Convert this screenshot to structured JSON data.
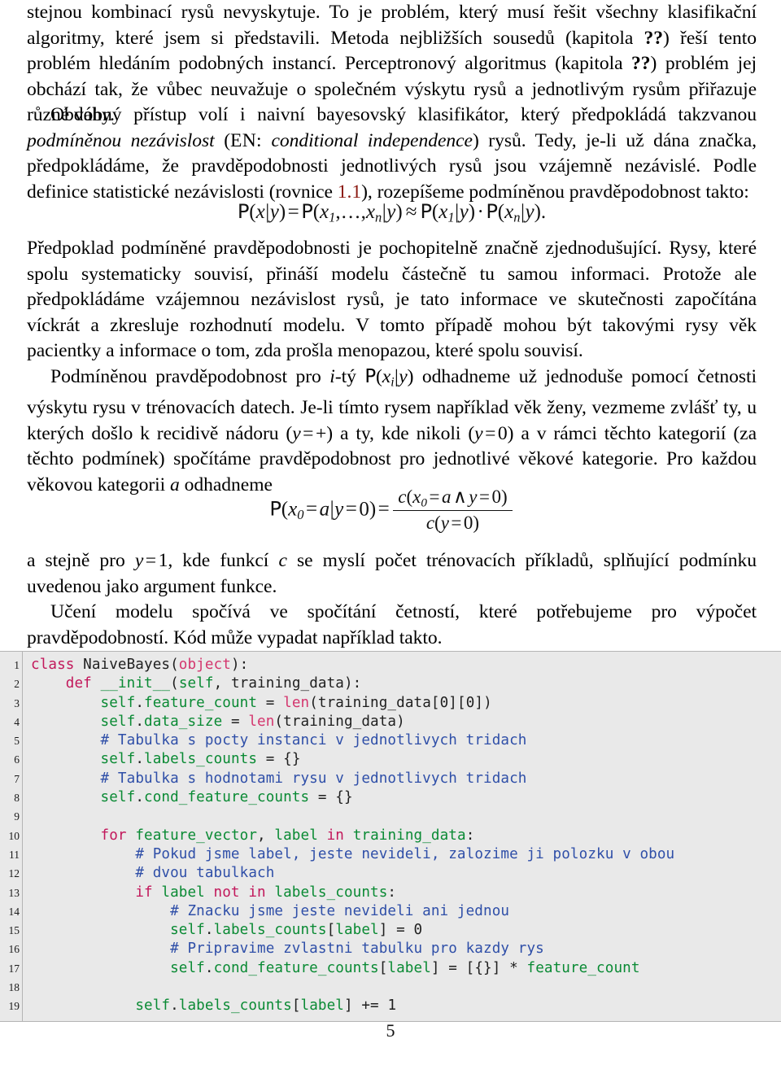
{
  "document": {
    "language": "cs",
    "page_number": "5"
  },
  "body": {
    "paragraph_1": {
      "parts": [
        "stejnou kombinací rysů nevyskytuje. To je problém, který musí řešit všechny klasifikační algoritmy, které jsem si představili. Metoda nejbližších sousedů (kapitola ",
        "??",
        ") řeší tento problém hledáním podobných instancí. Perceptronový algoritmus (kapitola ",
        "??",
        ") problém jej obchází tak, že vůbec neuvažuje o společném výskytu rysů a jednotlivým rysům přiřazuje různé váhy."
      ],
      "ref_marker_1": "??",
      "ref_marker_2": "??"
    },
    "paragraph_2": {
      "text_a": "Obdobný přístup volí i naivní bayesovský klasifikátor, který předpokládá takzvanou ",
      "em_a": "podmíněnou nezávislost",
      "text_b": " (",
      "smallcaps": "EN:",
      "text_c": " ",
      "em_b": "conditional independence",
      "text_d": ") rysů. Tedy, je-li už dána značka, předpokládáme, že pravděpodobnosti jednotlivých rysů jsou vzájemně nezávislé. Podle definice statistické nezávislosti (rovnice ",
      "ref": "1.1",
      "text_e": "), rozepíšeme podmíněnou pravděpodobnost takto:"
    },
    "equation_1": {
      "latex": "P(x|y) = P(x_1, ..., x_n|y) ≈ P(x_1|y) · P(x_n|y).",
      "tokens": {
        "P": "P",
        "x": "x",
        "y": "y",
        "n": "n",
        "one": "1",
        "eq": "=",
        "approx": "≈",
        "cdot": "·",
        "comma": ",",
        "dots": "…",
        "period": ".",
        "bar": "|"
      }
    },
    "paragraph_3": "Předpoklad podmíněné pravděpodobnosti je pochopitelně značně zjednodušující. Rysy, které spolu systematicky souvisí, přináší modelu částečně tu samou informaci. Protože ale předpokládáme vzájemnou nezávislost rysů, je tato informace ve skutečnosti započítána víckrát a zkresluje rozhodnutí modelu. V tomto případě mohou být takovými rysy věk pacientky a informace o tom, zda prošla menopazou, které spolu souvisí.",
    "paragraph_4": {
      "text_a": "Podmíněnou pravděpodobnost pro ",
      "em_i": "i",
      "text_b": "-tý ",
      "math": "P(x_i|y)",
      "text_c": " odhadneme už jednoduše pomocí četnosti výskytu rysu v trénovacích datech. Je-li tímto rysem například věk ženy, vezmeme zvlášť ty, u kterých došlo k recidivě nádoru ",
      "math_b": "(y = +)",
      "text_d": " a ty, kde nikoli ",
      "math_c": "(y = 0)",
      "text_e": " a v rámci těchto kategorií (za těchto podmínek) spočítáme pravděpodobnost pro jednotlivé věkové kategorie. Pro každou věkovou kategorii ",
      "em_a": "a",
      "text_f": " odhadneme"
    },
    "equation_2": {
      "latex": "P(x_0 = a|y = 0) = c(x_0 = a ∧ y = 0) / c(y = 0)",
      "tokens": {
        "P": "P",
        "c": "c",
        "x": "x",
        "y": "y",
        "a": "a",
        "zero": "0",
        "eq": "=",
        "wedge": "∧",
        "bar": "|"
      }
    },
    "paragraph_5": {
      "text_a": "a stejně pro ",
      "math": "y = 1",
      "text_b": ", kde funkcí ",
      "em_c": "c",
      "text_c": " se myslí počet trénovacích příkladů, splňující podmínku uvedenou jako argument funkce."
    },
    "paragraph_6": "Učení modelu spočívá ve spočítání četností, které potřebujeme pro výpočet pravděpodobností. Kód může vypadat například takto."
  },
  "code_block": {
    "language": "python",
    "colors": {
      "background": "#e9e9e9",
      "border": "#b4b4b4",
      "keyword": "#c2185b",
      "builtin": "#d4366e",
      "identifier": "#0a8a34",
      "comment": "#2f4fa8",
      "plain": "#1f1f1f"
    },
    "lines": [
      {
        "no": "1",
        "tokens": [
          {
            "t": "class ",
            "c": "kw"
          },
          {
            "t": "NaiveBayes",
            "c": "name"
          },
          {
            "t": "(",
            "c": "op"
          },
          {
            "t": "object",
            "c": "bi"
          },
          {
            "t": "):",
            "c": "op"
          }
        ]
      },
      {
        "no": "2",
        "tokens": [
          {
            "t": "    ",
            "c": "op"
          },
          {
            "t": "def ",
            "c": "kw"
          },
          {
            "t": "__init__",
            "c": "id"
          },
          {
            "t": "(",
            "c": "op"
          },
          {
            "t": "self",
            "c": "id"
          },
          {
            "t": ", training_data):",
            "c": "op"
          }
        ]
      },
      {
        "no": "3",
        "tokens": [
          {
            "t": "        ",
            "c": "op"
          },
          {
            "t": "self",
            "c": "id"
          },
          {
            "t": ".",
            "c": "op"
          },
          {
            "t": "feature_count",
            "c": "id"
          },
          {
            "t": " = ",
            "c": "op"
          },
          {
            "t": "len",
            "c": "bi"
          },
          {
            "t": "(training_data[",
            "c": "op"
          },
          {
            "t": "0",
            "c": "num"
          },
          {
            "t": "][",
            "c": "op"
          },
          {
            "t": "0",
            "c": "num"
          },
          {
            "t": "])",
            "c": "op"
          }
        ]
      },
      {
        "no": "4",
        "tokens": [
          {
            "t": "        ",
            "c": "op"
          },
          {
            "t": "self",
            "c": "id"
          },
          {
            "t": ".",
            "c": "op"
          },
          {
            "t": "data_size",
            "c": "id"
          },
          {
            "t": " = ",
            "c": "op"
          },
          {
            "t": "len",
            "c": "bi"
          },
          {
            "t": "(training_data)",
            "c": "op"
          }
        ]
      },
      {
        "no": "5",
        "tokens": [
          {
            "t": "        ",
            "c": "op"
          },
          {
            "t": "# Tabulka s pocty instanci v jednotlivych tridach",
            "c": "cm"
          }
        ]
      },
      {
        "no": "6",
        "tokens": [
          {
            "t": "        ",
            "c": "op"
          },
          {
            "t": "self",
            "c": "id"
          },
          {
            "t": ".",
            "c": "op"
          },
          {
            "t": "labels_counts",
            "c": "id"
          },
          {
            "t": " = {}",
            "c": "op"
          }
        ]
      },
      {
        "no": "7",
        "tokens": [
          {
            "t": "        ",
            "c": "op"
          },
          {
            "t": "# Tabulka s hodnotami rysu v jednotlivych tridach",
            "c": "cm"
          }
        ]
      },
      {
        "no": "8",
        "tokens": [
          {
            "t": "        ",
            "c": "op"
          },
          {
            "t": "self",
            "c": "id"
          },
          {
            "t": ".",
            "c": "op"
          },
          {
            "t": "cond_feature_counts",
            "c": "id"
          },
          {
            "t": " = {}",
            "c": "op"
          }
        ]
      },
      {
        "no": "9",
        "tokens": [
          {
            "t": "",
            "c": "op"
          }
        ]
      },
      {
        "no": "10",
        "tokens": [
          {
            "t": "        ",
            "c": "op"
          },
          {
            "t": "for ",
            "c": "kw"
          },
          {
            "t": "feature_vector",
            "c": "id"
          },
          {
            "t": ", ",
            "c": "op"
          },
          {
            "t": "label",
            "c": "id"
          },
          {
            "t": " ",
            "c": "op"
          },
          {
            "t": "in",
            "c": "kw"
          },
          {
            "t": " ",
            "c": "op"
          },
          {
            "t": "training_data",
            "c": "id"
          },
          {
            "t": ":",
            "c": "op"
          }
        ]
      },
      {
        "no": "11",
        "tokens": [
          {
            "t": "            ",
            "c": "op"
          },
          {
            "t": "# Pokud jsme label, jeste nevideli, zalozime ji polozku v obou",
            "c": "cm"
          }
        ]
      },
      {
        "no": "12",
        "tokens": [
          {
            "t": "            ",
            "c": "op"
          },
          {
            "t": "# dvou tabulkach",
            "c": "cm"
          }
        ]
      },
      {
        "no": "13",
        "tokens": [
          {
            "t": "            ",
            "c": "op"
          },
          {
            "t": "if ",
            "c": "kw"
          },
          {
            "t": "label ",
            "c": "id"
          },
          {
            "t": "not in",
            "c": "kw"
          },
          {
            "t": " ",
            "c": "op"
          },
          {
            "t": "labels_counts",
            "c": "id"
          },
          {
            "t": ":",
            "c": "op"
          }
        ]
      },
      {
        "no": "14",
        "tokens": [
          {
            "t": "                ",
            "c": "op"
          },
          {
            "t": "# Znacku jsme jeste nevideli ani jednou",
            "c": "cm"
          }
        ]
      },
      {
        "no": "15",
        "tokens": [
          {
            "t": "                ",
            "c": "op"
          },
          {
            "t": "self",
            "c": "id"
          },
          {
            "t": ".",
            "c": "op"
          },
          {
            "t": "labels_counts",
            "c": "id"
          },
          {
            "t": "[",
            "c": "op"
          },
          {
            "t": "label",
            "c": "id"
          },
          {
            "t": "] = ",
            "c": "op"
          },
          {
            "t": "0",
            "c": "num"
          }
        ]
      },
      {
        "no": "16",
        "tokens": [
          {
            "t": "                ",
            "c": "op"
          },
          {
            "t": "# Pripravime zvlastni tabulku pro kazdy rys",
            "c": "cm"
          }
        ]
      },
      {
        "no": "17",
        "tokens": [
          {
            "t": "                ",
            "c": "op"
          },
          {
            "t": "self",
            "c": "id"
          },
          {
            "t": ".",
            "c": "op"
          },
          {
            "t": "cond_feature_counts",
            "c": "id"
          },
          {
            "t": "[",
            "c": "op"
          },
          {
            "t": "label",
            "c": "id"
          },
          {
            "t": "] = [{}] * ",
            "c": "op"
          },
          {
            "t": "feature_count",
            "c": "id"
          }
        ]
      },
      {
        "no": "18",
        "tokens": [
          {
            "t": "",
            "c": "op"
          }
        ]
      },
      {
        "no": "19",
        "tokens": [
          {
            "t": "            ",
            "c": "op"
          },
          {
            "t": "self",
            "c": "id"
          },
          {
            "t": ".",
            "c": "op"
          },
          {
            "t": "labels_counts",
            "c": "id"
          },
          {
            "t": "[",
            "c": "op"
          },
          {
            "t": "label",
            "c": "id"
          },
          {
            "t": "] += ",
            "c": "op"
          },
          {
            "t": "1",
            "c": "num"
          }
        ]
      }
    ]
  }
}
